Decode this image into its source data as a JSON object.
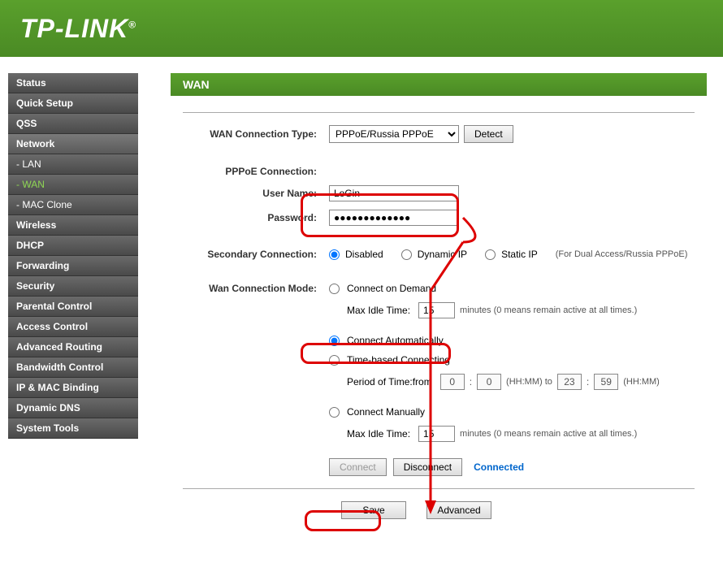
{
  "header": {
    "logo": "TP-LINK"
  },
  "sidebar": {
    "items": [
      {
        "label": "Status"
      },
      {
        "label": "Quick Setup"
      },
      {
        "label": "QSS"
      },
      {
        "label": "Network"
      },
      {
        "label": "- LAN"
      },
      {
        "label": "- WAN"
      },
      {
        "label": "- MAC Clone"
      },
      {
        "label": "Wireless"
      },
      {
        "label": "DHCP"
      },
      {
        "label": "Forwarding"
      },
      {
        "label": "Security"
      },
      {
        "label": "Parental Control"
      },
      {
        "label": "Access Control"
      },
      {
        "label": "Advanced Routing"
      },
      {
        "label": "Bandwidth Control"
      },
      {
        "label": "IP & MAC Binding"
      },
      {
        "label": "Dynamic DNS"
      },
      {
        "label": "System Tools"
      }
    ]
  },
  "page": {
    "title": "WAN"
  },
  "form": {
    "conn_type_label": "WAN Connection Type:",
    "conn_type_value": "PPPoE/Russia PPPoE",
    "detect_btn": "Detect",
    "pppoe_label": "PPPoE Connection:",
    "username_label": "User Name:",
    "username_value": "LoGin",
    "password_label": "Password:",
    "password_value": "●●●●●●●●●●●●●",
    "secondary_label": "Secondary Connection:",
    "secondary_disabled": "Disabled",
    "secondary_dynamic": "Dynamic IP",
    "secondary_static": "Static IP",
    "secondary_help": "(For Dual Access/Russia PPPoE)",
    "mode_label": "Wan Connection Mode:",
    "mode_demand": "Connect on Demand",
    "mode_auto": "Connect Automatically",
    "mode_time": "Time-based Connecting",
    "mode_manual": "Connect Manually",
    "idle_label": "Max Idle Time:",
    "idle_value": "15",
    "idle_help": "minutes (0 means remain active at all times.)",
    "period_label": "Period of Time:from",
    "period_from_h": "0",
    "period_from_m": "0",
    "period_sep": ":",
    "period_hhmm_to": "(HH:MM) to",
    "period_to_h": "23",
    "period_to_m": "59",
    "period_hhmm": "(HH:MM)",
    "connect_btn": "Connect",
    "disconnect_btn": "Disconnect",
    "status": "Connected",
    "save_btn": "Save",
    "advanced_btn": "Advanced"
  }
}
